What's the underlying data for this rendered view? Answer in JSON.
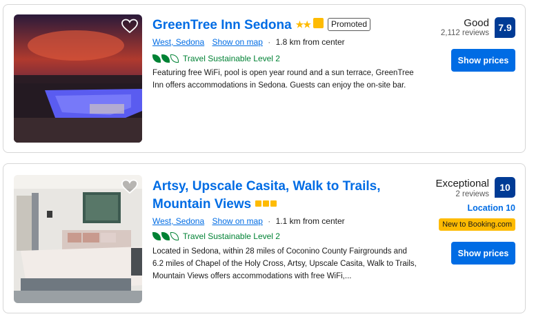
{
  "colors": {
    "link": "#006ce4",
    "score_bg": "#003b95",
    "star": "#febb02",
    "sustainable": "#008234",
    "button": "#006ce4"
  },
  "listings": [
    {
      "title": "GreenTree Inn Sedona",
      "stars": "★★",
      "promoted": "Promoted",
      "location": "West, Sedona",
      "map_link": "Show on map",
      "distance": "1.8 km from center",
      "sustainable": "Travel Sustainable Level 2",
      "description": "Featuring free WiFi, pool is open year round and a sun terrace, GreenTree Inn offers accommodations in Sedona. Guests can enjoy the on-site bar.",
      "rating_word": "Good",
      "reviews": "2,112 reviews",
      "score": "7.9",
      "button": "Show prices"
    },
    {
      "title": "Artsy, Upscale Casita, Walk to Trails, Mountain Views",
      "location": "West, Sedona",
      "map_link": "Show on map",
      "distance": "1.1 km from center",
      "sustainable": "Travel Sustainable Level 2",
      "description": "Located in Sedona, within 28 miles of Coconino County Fairgrounds and 6.2 miles of Chapel of the Holy Cross, Artsy, Upscale Casita, Walk to Trails, Mountain Views offers accommodations with free WiFi,...",
      "rating_word": "Exceptional",
      "reviews": "2 reviews",
      "score": "10",
      "location_score": "Location 10",
      "new_badge": "New to Booking.com",
      "button": "Show prices"
    }
  ]
}
